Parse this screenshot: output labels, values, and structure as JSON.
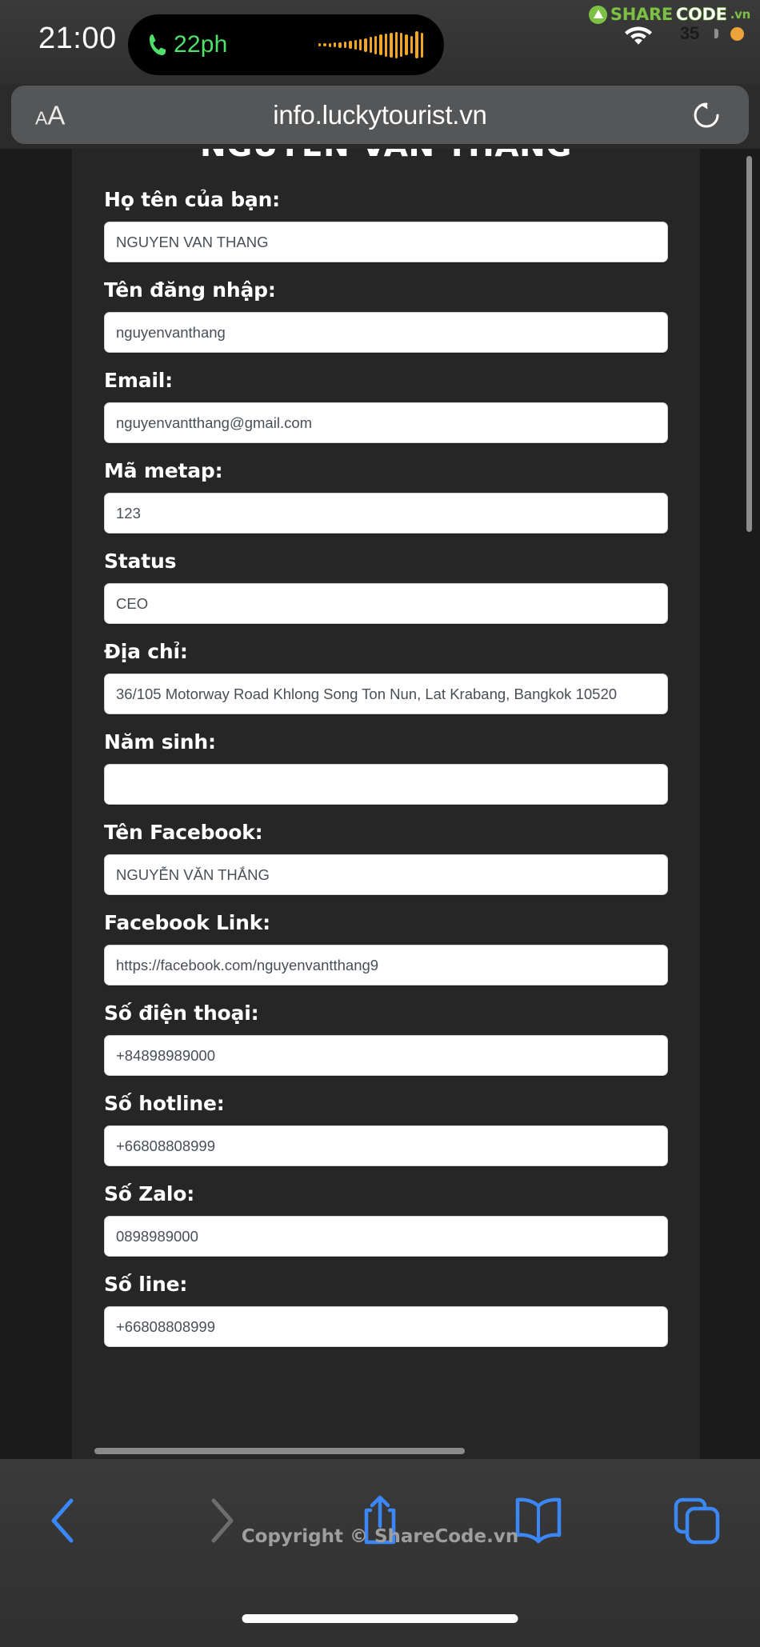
{
  "status_bar": {
    "time": "21:00",
    "call_label": "22ph",
    "phone_icon": "phone-call-icon",
    "waveform_icon": "audio-waveform-icon",
    "wifi_icon": "wifi-icon",
    "battery_level": "35",
    "battery_percent": 35,
    "focus_indicator_icon": "orange-dot-icon"
  },
  "watermark": {
    "logo_share": "SHARE",
    "logo_code": "CODE",
    "logo_vn": ".vn",
    "url_overlay": "ShareCode.vn",
    "copyright": "Copyright © ShareCode.vn"
  },
  "browser": {
    "text_size_small": "A",
    "text_size_large": "A",
    "url": "info.luckytourist.vn",
    "reload_icon": "reload-icon",
    "toolbar": {
      "back_icon": "chevron-left-icon",
      "forward_icon": "chevron-right-icon",
      "share_icon": "share-upload-icon",
      "bookmarks_icon": "book-bookmarks-icon",
      "tabs_icon": "copy-tabs-icon"
    }
  },
  "page": {
    "title": "NGUYEN VAN THANG",
    "fields": [
      {
        "label": "Họ tên của bạn:",
        "value": "NGUYEN VAN THANG"
      },
      {
        "label": "Tên đăng nhập:",
        "value": "nguyenvanthang"
      },
      {
        "label": "Email:",
        "value": "nguyenvantthang@gmail.com"
      },
      {
        "label": "Mã metap:",
        "value": "123"
      },
      {
        "label": "Status",
        "value": "CEO"
      },
      {
        "label": "Địa chỉ:",
        "value": "36/105 Motorway Road Khlong Song Ton Nun, Lat Krabang, Bangkok 10520"
      },
      {
        "label": "Năm sinh:",
        "value": ""
      },
      {
        "label": "Tên Facebook:",
        "value": "NGUYỄN VĂN THẮNG"
      },
      {
        "label": "Facebook Link:",
        "value": "https://facebook.com/nguyenvantthang9"
      },
      {
        "label": "Số điện thoại:",
        "value": "+84898989000"
      },
      {
        "label": "Số hotline:",
        "value": "+66808808999"
      },
      {
        "label": "Số Zalo:",
        "value": "0898989000"
      },
      {
        "label": "Số line:",
        "value": "+66808808999"
      }
    ]
  },
  "colors": {
    "page_bg": "#262626",
    "webview_bg": "#1b1b1b",
    "chrome_bg": "#343434",
    "accent_blue": "#3b87f7",
    "call_green": "#4fe06a",
    "waveform_orange": "#f0a623",
    "brand_green": "#7cc143"
  }
}
